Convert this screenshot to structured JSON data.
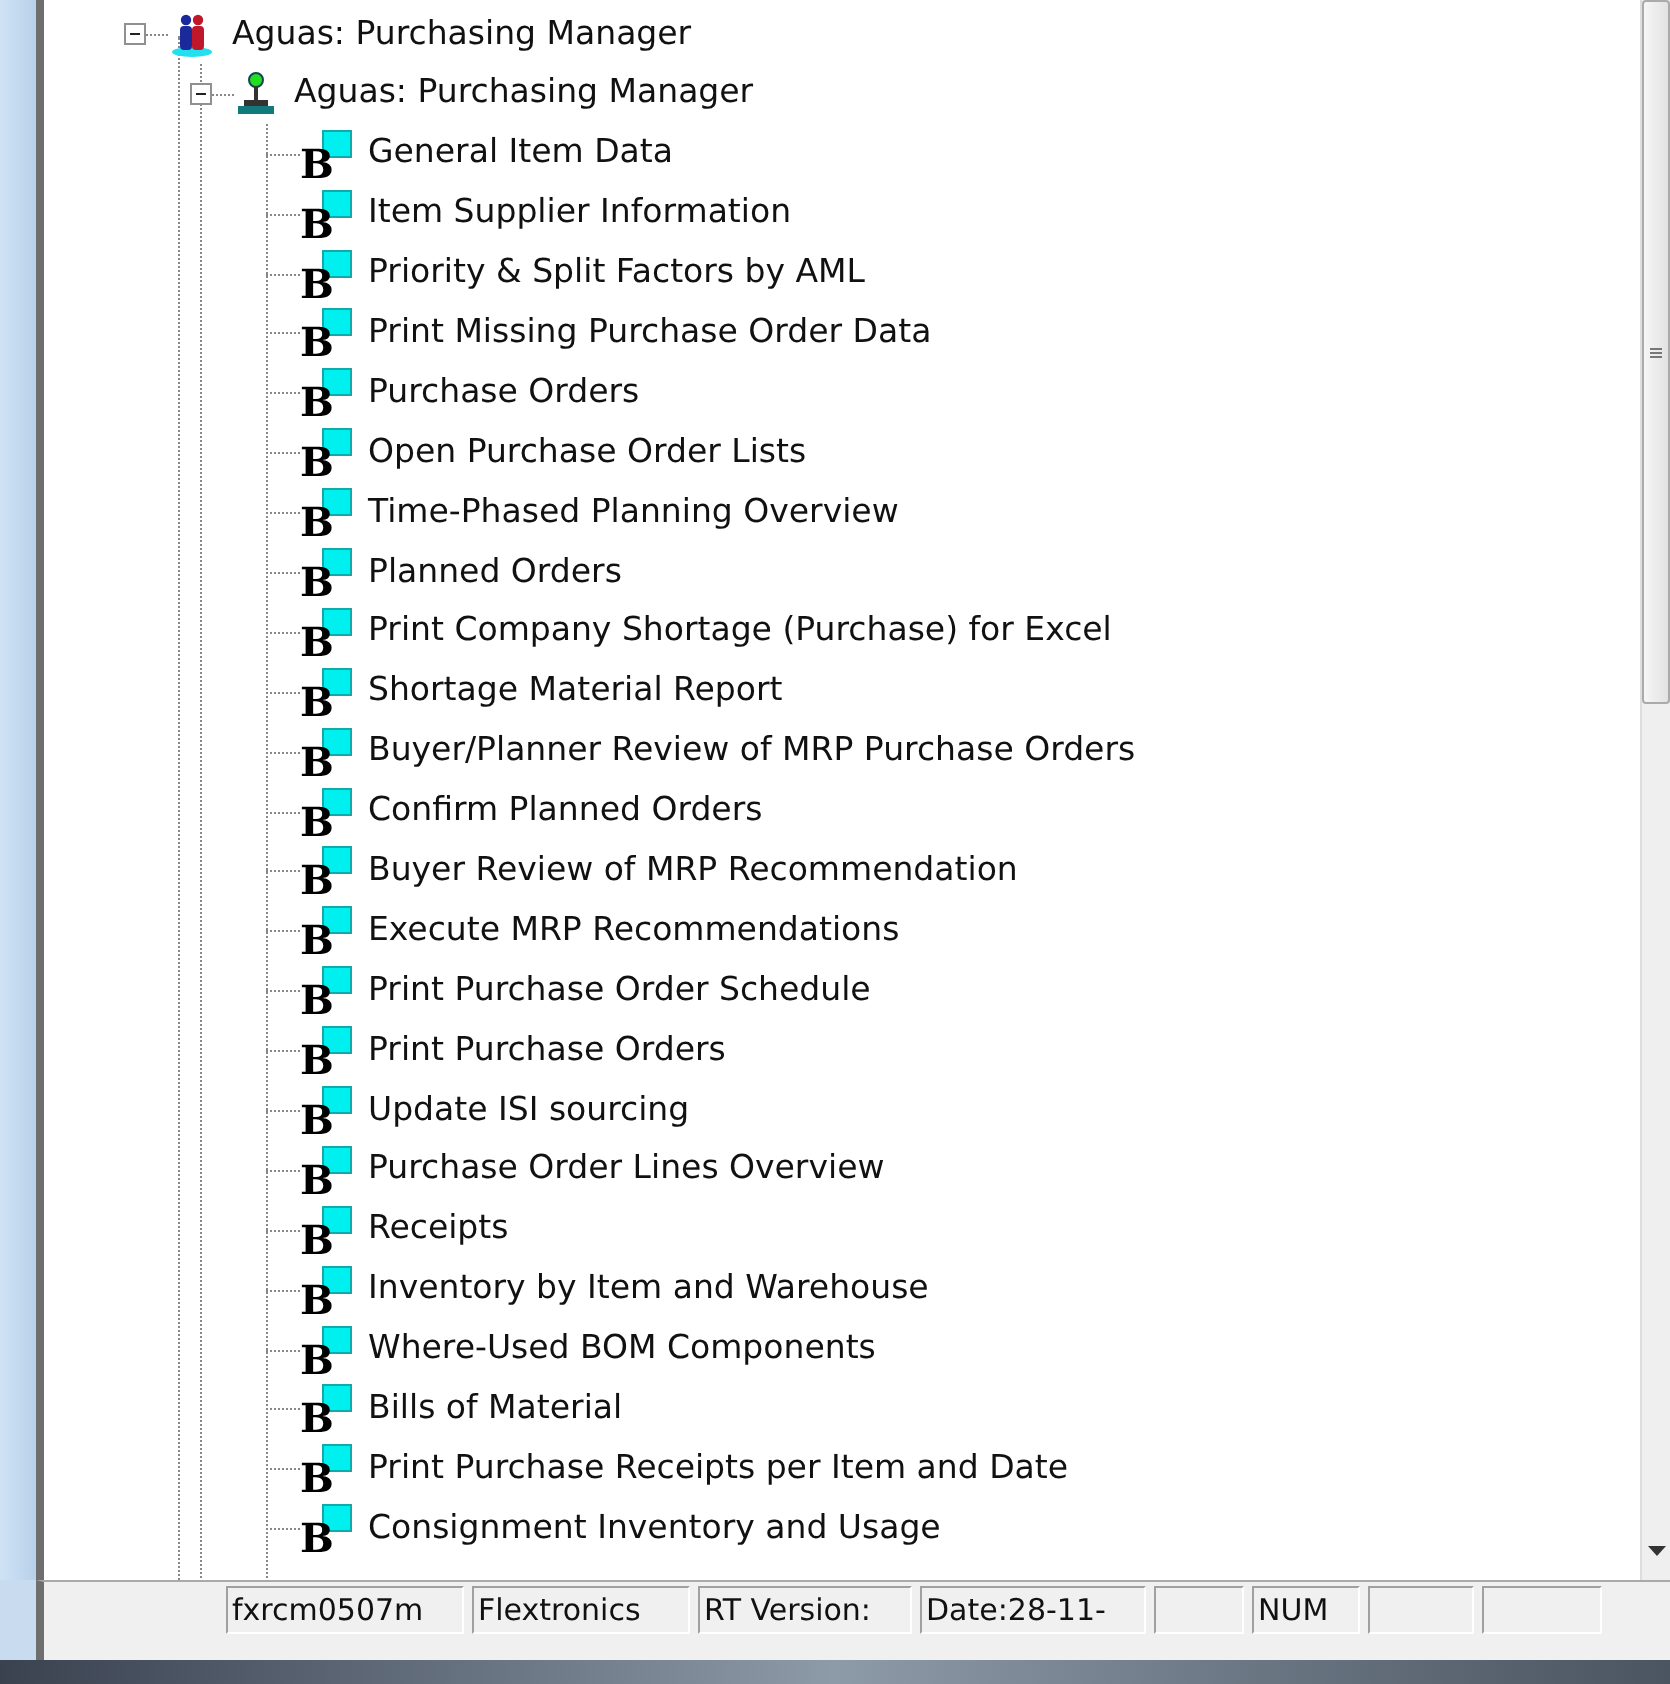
{
  "tree": [
    {
      "kind": "group",
      "label": "Aguas: Purchasing Manager",
      "expanded": true,
      "children": [
        {
          "kind": "user",
          "label": "Aguas: Purchasing Manager",
          "expanded": true,
          "children": [
            {
              "kind": "session",
              "glyph": "B",
              "label": "General Item Data"
            },
            {
              "kind": "session",
              "glyph": "B",
              "label": "Item Supplier Information"
            },
            {
              "kind": "session",
              "glyph": "B",
              "label": "Priority & Split Factors by AML"
            },
            {
              "kind": "session",
              "glyph": "B",
              "label": "Print Missing Purchase Order Data"
            },
            {
              "kind": "session",
              "glyph": "B",
              "label": "Purchase Orders"
            },
            {
              "kind": "session",
              "glyph": "B",
              "label": "Open Purchase Order Lists"
            },
            {
              "kind": "session",
              "glyph": "B",
              "label": "Time-Phased Planning Overview"
            },
            {
              "kind": "session",
              "glyph": "B",
              "label": "Planned Orders"
            },
            {
              "kind": "session",
              "glyph": "B",
              "label": "Print Company Shortage (Purchase) for Excel"
            },
            {
              "kind": "session",
              "glyph": "B",
              "label": "Shortage Material Report"
            },
            {
              "kind": "session",
              "glyph": "B",
              "label": "Buyer/Planner Review of MRP Purchase Orders"
            },
            {
              "kind": "session",
              "glyph": "B",
              "label": "Confirm Planned Orders"
            },
            {
              "kind": "session",
              "glyph": "B",
              "label": "Buyer Review of MRP Recommendation"
            },
            {
              "kind": "session",
              "glyph": "B",
              "label": "Execute MRP Recommendations"
            },
            {
              "kind": "session",
              "glyph": "B",
              "label": "Print Purchase Order Schedule"
            },
            {
              "kind": "session",
              "glyph": "B",
              "label": "Print Purchase Orders"
            },
            {
              "kind": "session",
              "glyph": "B",
              "label": "Update ISI sourcing"
            },
            {
              "kind": "session",
              "glyph": "B",
              "label": "Purchase Order Lines Overview"
            },
            {
              "kind": "session",
              "glyph": "B",
              "label": "Receipts"
            },
            {
              "kind": "session",
              "glyph": "B",
              "label": "Inventory by Item and Warehouse"
            },
            {
              "kind": "session",
              "glyph": "B",
              "label": "Where-Used BOM Components"
            },
            {
              "kind": "session",
              "glyph": "B",
              "label": "Bills of Material"
            },
            {
              "kind": "session",
              "glyph": "B",
              "label": "Print Purchase Receipts per Item and Date"
            },
            {
              "kind": "session",
              "glyph": "B",
              "label": "Consignment Inventory and Usage"
            }
          ]
        }
      ]
    }
  ],
  "status_bar": [
    {
      "kind": "text",
      "text": "fxrcm0507m"
    },
    {
      "kind": "text",
      "text": "Flextronics"
    },
    {
      "kind": "text",
      "text": "RT Version:"
    },
    {
      "kind": "text",
      "text": "Date:28-11-"
    },
    {
      "kind": "blank"
    },
    {
      "kind": "text",
      "text": "NUM"
    },
    {
      "kind": "blank"
    },
    {
      "kind": "blank"
    }
  ]
}
